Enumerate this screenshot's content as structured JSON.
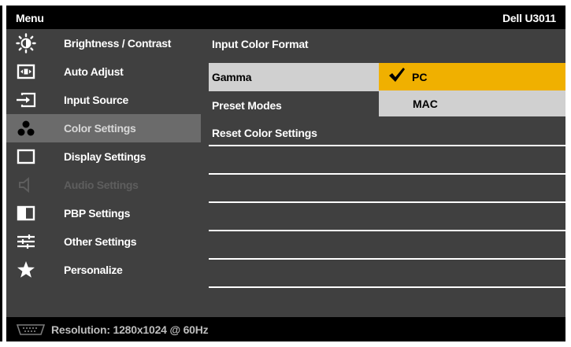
{
  "header": {
    "menu_title": "Menu",
    "model": "Dell U3011"
  },
  "sidebar": {
    "items": [
      {
        "label": "Brightness / Contrast",
        "icon": "brightness-icon",
        "state": "normal"
      },
      {
        "label": "Auto Adjust",
        "icon": "auto-adjust-icon",
        "state": "normal"
      },
      {
        "label": "Input Source",
        "icon": "input-source-icon",
        "state": "normal"
      },
      {
        "label": "Color Settings",
        "icon": "color-settings-icon",
        "state": "active"
      },
      {
        "label": "Display Settings",
        "icon": "display-settings-icon",
        "state": "normal"
      },
      {
        "label": "Audio Settings",
        "icon": "audio-settings-icon",
        "state": "disabled"
      },
      {
        "label": "PBP Settings",
        "icon": "pbp-settings-icon",
        "state": "normal"
      },
      {
        "label": "Other Settings",
        "icon": "other-settings-icon",
        "state": "normal"
      },
      {
        "label": "Personalize",
        "icon": "personalize-icon",
        "state": "normal"
      }
    ]
  },
  "main": {
    "options": [
      {
        "label": "Input Color Format"
      },
      {
        "label": "Gamma"
      },
      {
        "label": "Preset Modes"
      },
      {
        "label": "Reset Color Settings"
      }
    ],
    "submenu": {
      "items": [
        {
          "label": "PC",
          "checked": true
        },
        {
          "label": "MAC",
          "checked": false
        }
      ]
    }
  },
  "status": {
    "text": "Resolution: 1280x1024 @ 60Hz",
    "icon": "vga-connector-icon"
  },
  "colors": {
    "highlight": "#f0b000",
    "selected_row": "#d0d0d0",
    "panel": "#404040",
    "active_nav": "#6b6b6b"
  }
}
